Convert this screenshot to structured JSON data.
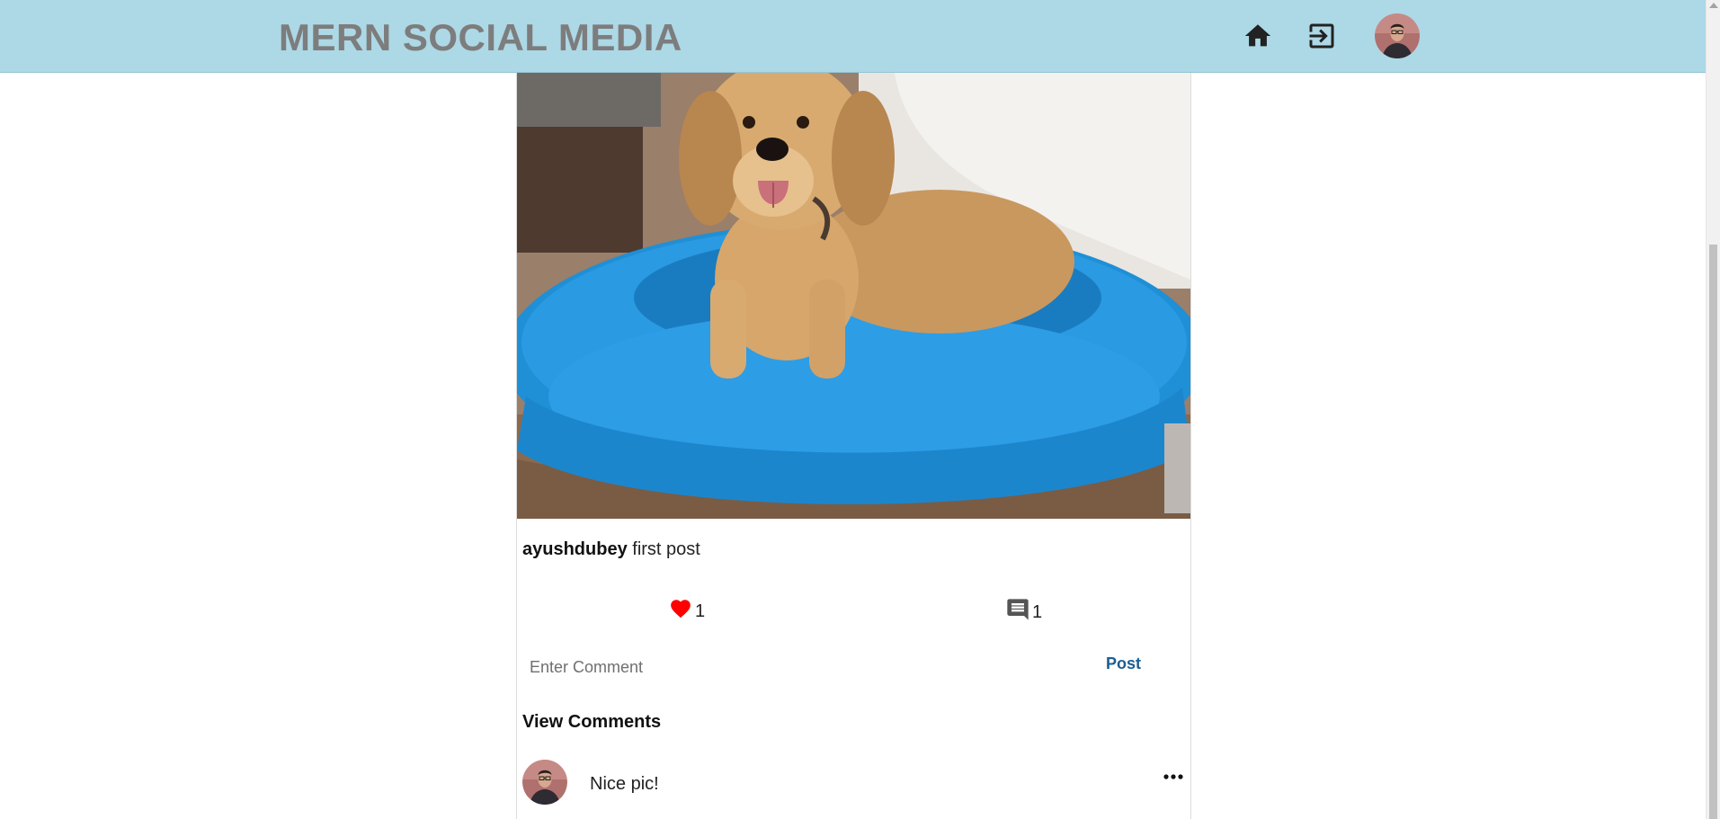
{
  "app": {
    "brand": "MERN SOCIAL MEDIA"
  },
  "nav": {
    "home_icon": "home-icon",
    "logout_icon": "logout-icon",
    "avatar": "user-avatar"
  },
  "post": {
    "image": "dog-on-blue-fluffy-bed",
    "username": "ayushdubey",
    "caption": "first post",
    "likes": "1",
    "comments_count": "1",
    "comment_placeholder": "Enter Comment",
    "post_button": "Post",
    "view_comments": "View Comments"
  },
  "comments": [
    {
      "text": "Nice pic!"
    }
  ],
  "colors": {
    "navbar_bg": "#add8e6",
    "brand_text": "#7d7d7d",
    "like_heart": "#ff0000",
    "post_button": "#1a5e93"
  }
}
